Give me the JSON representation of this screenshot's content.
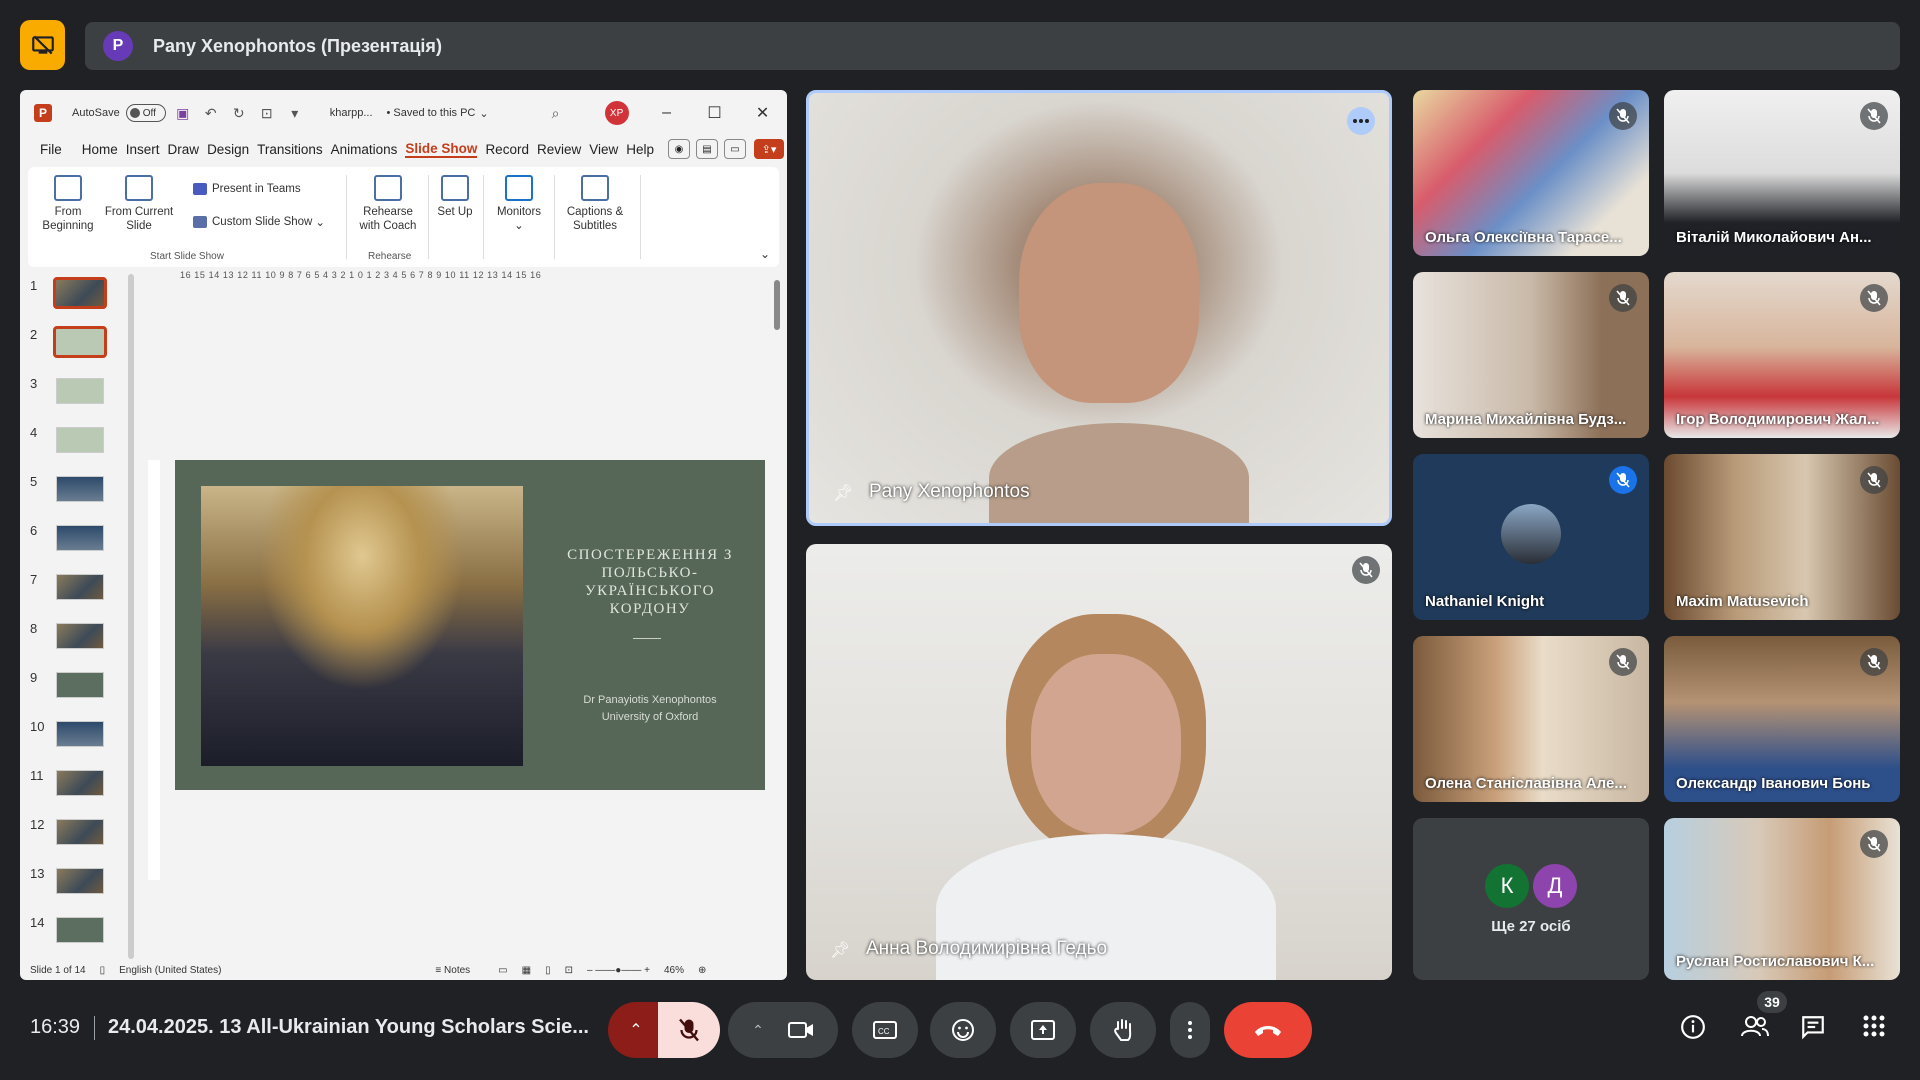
{
  "presenter_bar": {
    "avatar_letter": "P",
    "text": "Pany Xenophontos (Презентація)"
  },
  "ppt": {
    "autosave_label": "AutoSave",
    "autosave_state": "Off",
    "filename": "kharpp...",
    "saved_status": "• Saved to this PC",
    "user_initials": "XP",
    "menu": [
      "File",
      "Home",
      "Insert",
      "Draw",
      "Design",
      "Transitions",
      "Animations",
      "Slide Show",
      "Record",
      "Review",
      "View",
      "Help"
    ],
    "active_menu": "Slide Show",
    "ribbon": {
      "from_beginning": "From Beginning",
      "from_current": "From Current Slide",
      "present_teams": "Present in Teams",
      "custom_show": "Custom Slide Show",
      "group_start": "Start Slide Show",
      "rehearse": "Rehearse with Coach",
      "group_rehearse": "Rehearse",
      "setup": "Set Up",
      "monitors": "Monitors",
      "captions": "Captions & Subtitles"
    },
    "thumbnails": [
      "1",
      "2",
      "3",
      "4",
      "5",
      "6",
      "7",
      "8",
      "9",
      "10",
      "11",
      "12",
      "13",
      "14"
    ],
    "ruler": "16 15 14 13 12 11 10 9 8 7 6 5 4 3 2 1 0 1 2 3 4 5 6 7 8 9 10 11 12 13 14 15 16",
    "slide": {
      "title": "СПОСТЕРЕЖЕННЯ З ПОЛЬСЬКО-УКРАЇНСЬКОГО КОРДОНУ",
      "author_line1": "Dr Panayiotis Xenophontos",
      "author_line2": "University of Oxford"
    },
    "status": {
      "slide_count": "Slide 1 of 14",
      "language": "English (United States)",
      "notes": "Notes",
      "zoom": "46%"
    }
  },
  "tiles": {
    "main_presenter": "Pany Xenophontos",
    "second_speaker": "Анна Володимирівна Гедьо",
    "grid": [
      "Ольга Олексіївна Тарасе...",
      "Віталій Миколайович Ан...",
      "Марина Михайлівна Будз...",
      "Ігор Володимирович Жал...",
      "Nathaniel Knight",
      "Maxim Matusevich",
      "Олена Станіславівна Але...",
      "Олександр Іванович Бонь",
      "Руслан Ростиславович К..."
    ],
    "more": {
      "letter1": "К",
      "letter2": "Д",
      "text": "Ще 27 осіб"
    }
  },
  "bottom": {
    "time": "16:39",
    "meeting_title": "24.04.2025. 13 All-Ukrainian Young Scholars Scie...",
    "participants_count": "39"
  },
  "colors": {
    "end_call": "#ea4335",
    "mic_off_bg": "#f9dedc",
    "raise_arrow_bg": "#8c1d18",
    "presenting_badge": "#f9ab00",
    "speaking_border": "#aecbfa"
  }
}
